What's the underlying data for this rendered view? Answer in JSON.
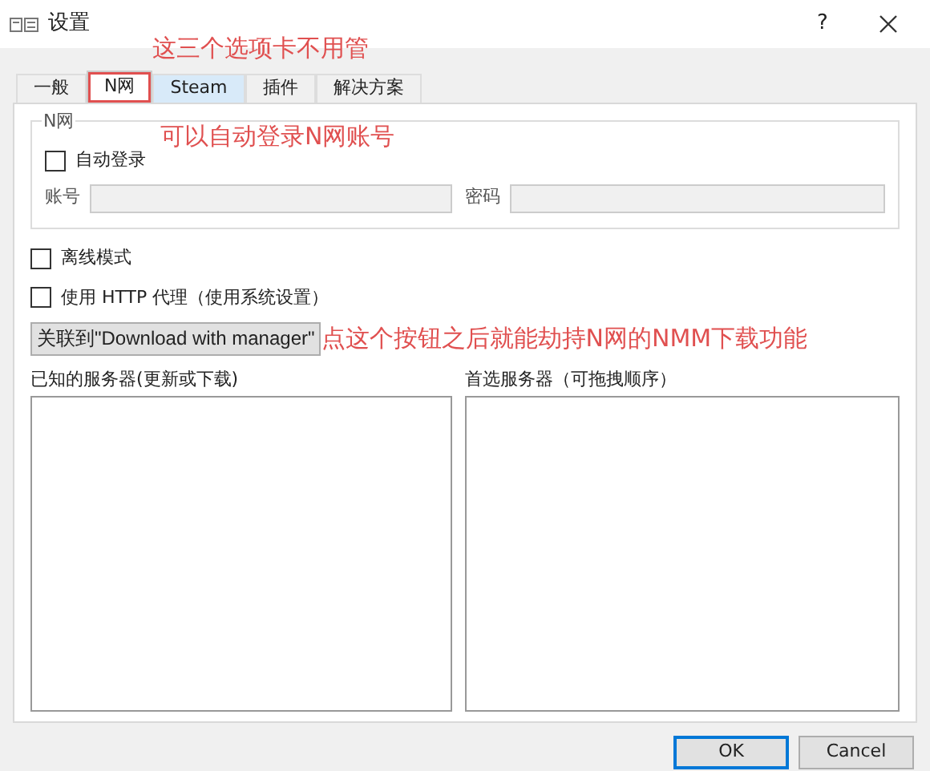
{
  "window": {
    "title": "设置",
    "help": "?"
  },
  "tabs": [
    {
      "label": "一般",
      "selected": false,
      "hovered": false,
      "marked": false
    },
    {
      "label": "N网",
      "selected": true,
      "hovered": false,
      "marked": true
    },
    {
      "label": "Steam",
      "selected": false,
      "hovered": true,
      "marked": false
    },
    {
      "label": "插件",
      "selected": false,
      "hovered": false,
      "marked": false
    },
    {
      "label": "解决方案",
      "selected": false,
      "hovered": false,
      "marked": false
    }
  ],
  "nexus_group": {
    "title": "N网",
    "auto_login": {
      "label": "自动登录",
      "checked": false
    },
    "account_label": "账号",
    "password_label": "密码"
  },
  "options": [
    {
      "label": "离线模式",
      "checked": false
    },
    {
      "label": "使用 HTTP 代理（使用系统设置）",
      "checked": false
    }
  ],
  "associate_button": "关联到\"Download with manager\"",
  "known_servers_label": "已知的服务器(更新或下载)",
  "preferred_servers_label": "首选服务器（可拖拽顺序）",
  "buttons": [
    {
      "label": "OK",
      "default": true
    },
    {
      "label": "Cancel",
      "default": false
    }
  ],
  "annotations": [
    "这三个选项卡不用管",
    "可以自动登录N网账号",
    "点这个按钮之后就能劫持N网的NMM下载功能"
  ]
}
